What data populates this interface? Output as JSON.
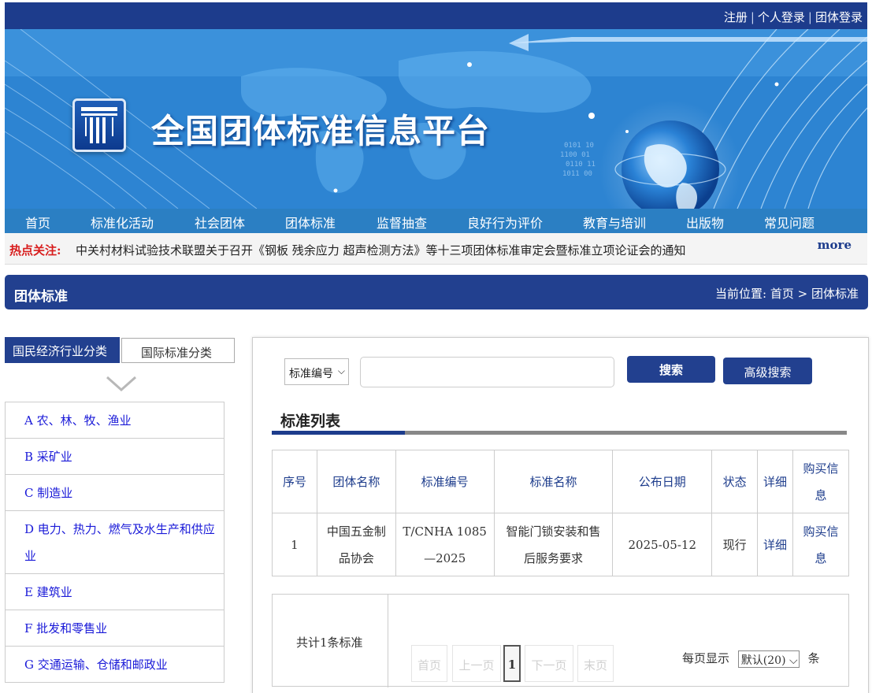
{
  "header": {
    "register": "注册",
    "personal_login": "个人登录",
    "group_login": "团体登录",
    "site_title": "全国团体标准信息平台"
  },
  "nav": [
    "首页",
    "标准化活动",
    "社会团体",
    "团体标准",
    "监督抽查",
    "良好行为评价",
    "教育与培训",
    "出版物",
    "常见问题"
  ],
  "hot": {
    "label": "热点关注:",
    "text": "中关村材料试验技术联盟关于召开《钢板 残余应力 超声检测方法》等十三项团体标准审定会暨标准立项论证会的通知",
    "more": "more"
  },
  "section": {
    "title": "团体标准",
    "crumb_label": "当前位置:",
    "crumb_home": "首页",
    "crumb_current": "团体标准"
  },
  "tabs": {
    "active": "国民经济行业分类",
    "inactive": "国际标准分类"
  },
  "categories": [
    "A 农、林、牧、渔业",
    "B 采矿业",
    "C 制造业",
    "D 电力、热力、燃气及水生产和供应业",
    "E 建筑业",
    "F 批发和零售业",
    "G 交通运输、仓储和邮政业"
  ],
  "search": {
    "select_value": "标准编号",
    "search_btn": "搜索",
    "advanced_btn": "高级搜索",
    "input_value": ""
  },
  "list": {
    "title": "标准列表",
    "headers": [
      "序号",
      "团体名称",
      "标准编号",
      "标准名称",
      "公布日期",
      "状态",
      "详细",
      "购买信息"
    ],
    "rows": [
      {
        "no": "1",
        "org": "中国五金制品协会",
        "code": "T/CNHA 1085—2025",
        "name": "智能门锁安装和售后服务要求",
        "date": "2025-05-12",
        "status": "现行",
        "detail": "详细",
        "buy": "购买信息"
      }
    ]
  },
  "pager": {
    "count": "共计1条标准",
    "first": "首页",
    "prev": "上一页",
    "current": "1",
    "next": "下一页",
    "last": "末页",
    "per_page_label": "每页显示",
    "per_page_value": "默认(20)",
    "per_page_unit": "条"
  }
}
